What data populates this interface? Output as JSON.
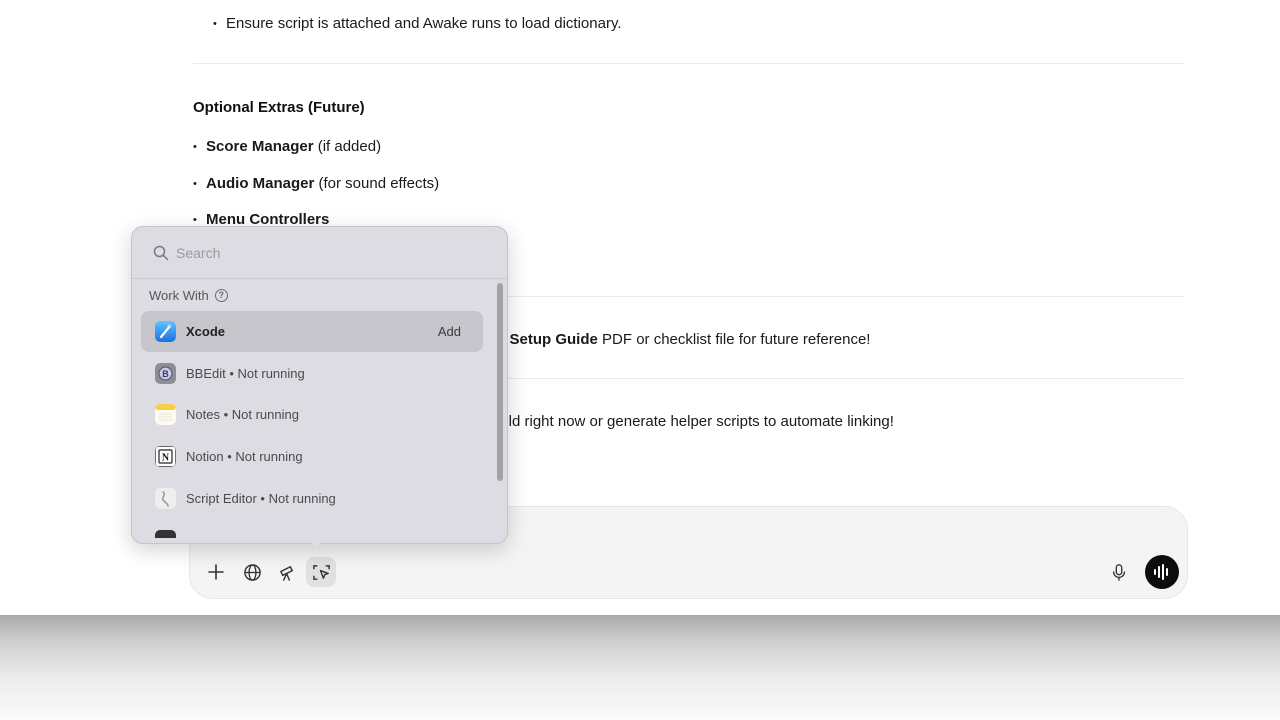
{
  "chat": {
    "top_bullet": "Ensure script is attached and Awake runs to load dictionary.",
    "section_heading": "Optional Extras (Future)",
    "extras": [
      {
        "bold": "Score Manager",
        "rest": " (if added)"
      },
      {
        "bold": "Audio Manager",
        "rest": " (for sound effects)"
      },
      {
        "bold": "Menu Controllers",
        "rest": ""
      }
    ],
    "para1_bold": "e Setup Guide",
    "para1_rest": " PDF or checklist file for future reference!",
    "para2": "ield right now or generate helper scripts to automate linking!"
  },
  "popover": {
    "search_placeholder": "Search",
    "section_label": "Work With",
    "apps": [
      {
        "label": "Xcode",
        "action": "Add",
        "icon": "xcode-icon"
      },
      {
        "label": "BBEdit • Not running",
        "icon": "bbedit-icon"
      },
      {
        "label": "Notes • Not running",
        "icon": "notes-icon"
      },
      {
        "label": "Notion • Not running",
        "icon": "notion-icon"
      },
      {
        "label": "Script Editor • Not running",
        "icon": "script-editor-icon"
      }
    ]
  },
  "composer": {
    "tools": [
      "plus-icon",
      "globe-icon",
      "telescope-icon",
      "work-with-apps-icon"
    ],
    "mic": "microphone-icon",
    "voice": "voice-mode-icon"
  },
  "colors": {
    "popover_bg": "#dcdce2",
    "selected_row": "#c6c6cc",
    "composer_bg": "#f4f4f4",
    "voice_button": "#0d0d0d"
  }
}
